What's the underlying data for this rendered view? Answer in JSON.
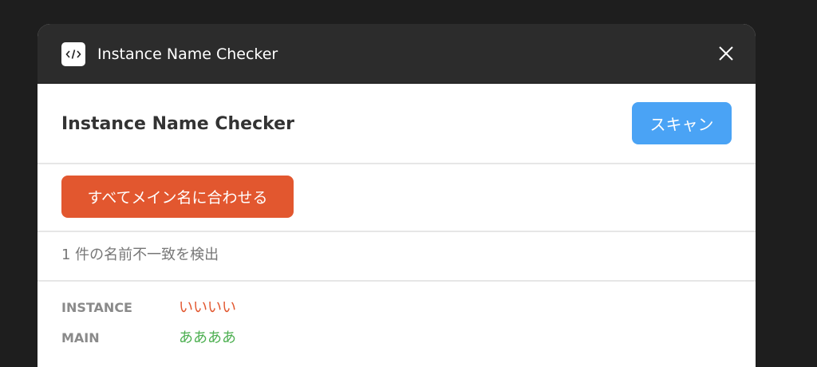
{
  "window": {
    "title": "Instance Name Checker",
    "app_icon": "code-icon",
    "close_icon": "close-icon"
  },
  "header": {
    "title": "Instance Name Checker",
    "scan_label": "スキャン"
  },
  "actions": {
    "match_all_label": "すべてメイン名に合わせる"
  },
  "status": {
    "text": "1 件の名前不一致を検出"
  },
  "result": {
    "instance_label": "INSTANCE",
    "instance_value": "いいいい",
    "main_label": "MAIN",
    "main_value": "ああああ"
  },
  "colors": {
    "scan_button": "#4aa3f5",
    "match_button": "#e2572f",
    "instance_value": "#e2572f",
    "main_value": "#4caf50"
  }
}
